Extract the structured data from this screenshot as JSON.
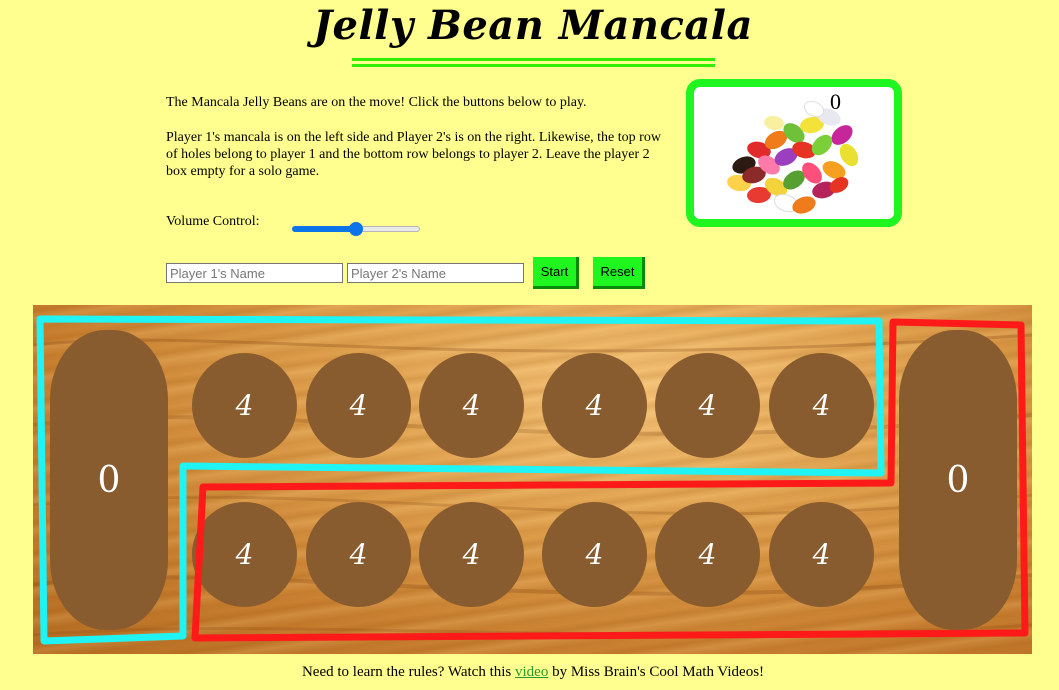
{
  "title": "Jelly Bean Mancala",
  "intro": {
    "paragraph1": "The Mancala Jelly Beans are on the move! Click the buttons below to play.",
    "paragraph2": "Player 1's mancala is on the left side and Player 2's is on the right. Likewise, the top row of holes belong to player 1 and the bottom row belongs to player 2. Leave the player 2 box empty for a solo game."
  },
  "volume": {
    "label": "Volume Control:",
    "level": 0.5
  },
  "inputs": {
    "player1_placeholder": "Player 1's Name",
    "player2_placeholder": "Player 2's Name"
  },
  "buttons": {
    "start": "Start",
    "reset": "Reset"
  },
  "bean_box": {
    "count": "0",
    "image": "jelly-beans-pile"
  },
  "board": {
    "player1_mancala": "0",
    "player2_mancala": "0",
    "top_row": [
      "4",
      "4",
      "4",
      "4",
      "4",
      "4"
    ],
    "bottom_row": [
      "4",
      "4",
      "4",
      "4",
      "4",
      "4"
    ],
    "player1_outline_color": "#1ff3f3",
    "player2_outline_color": "#ff1a1a"
  },
  "footer": {
    "text_before": "Need to learn the rules? Watch this ",
    "link_text": "video",
    "text_after": " by Miss Brain's Cool Math Videos!"
  },
  "colors": {
    "background": "#ffff8f",
    "accent_green": "#1ff51f",
    "pit_brown": "#885c2e"
  }
}
